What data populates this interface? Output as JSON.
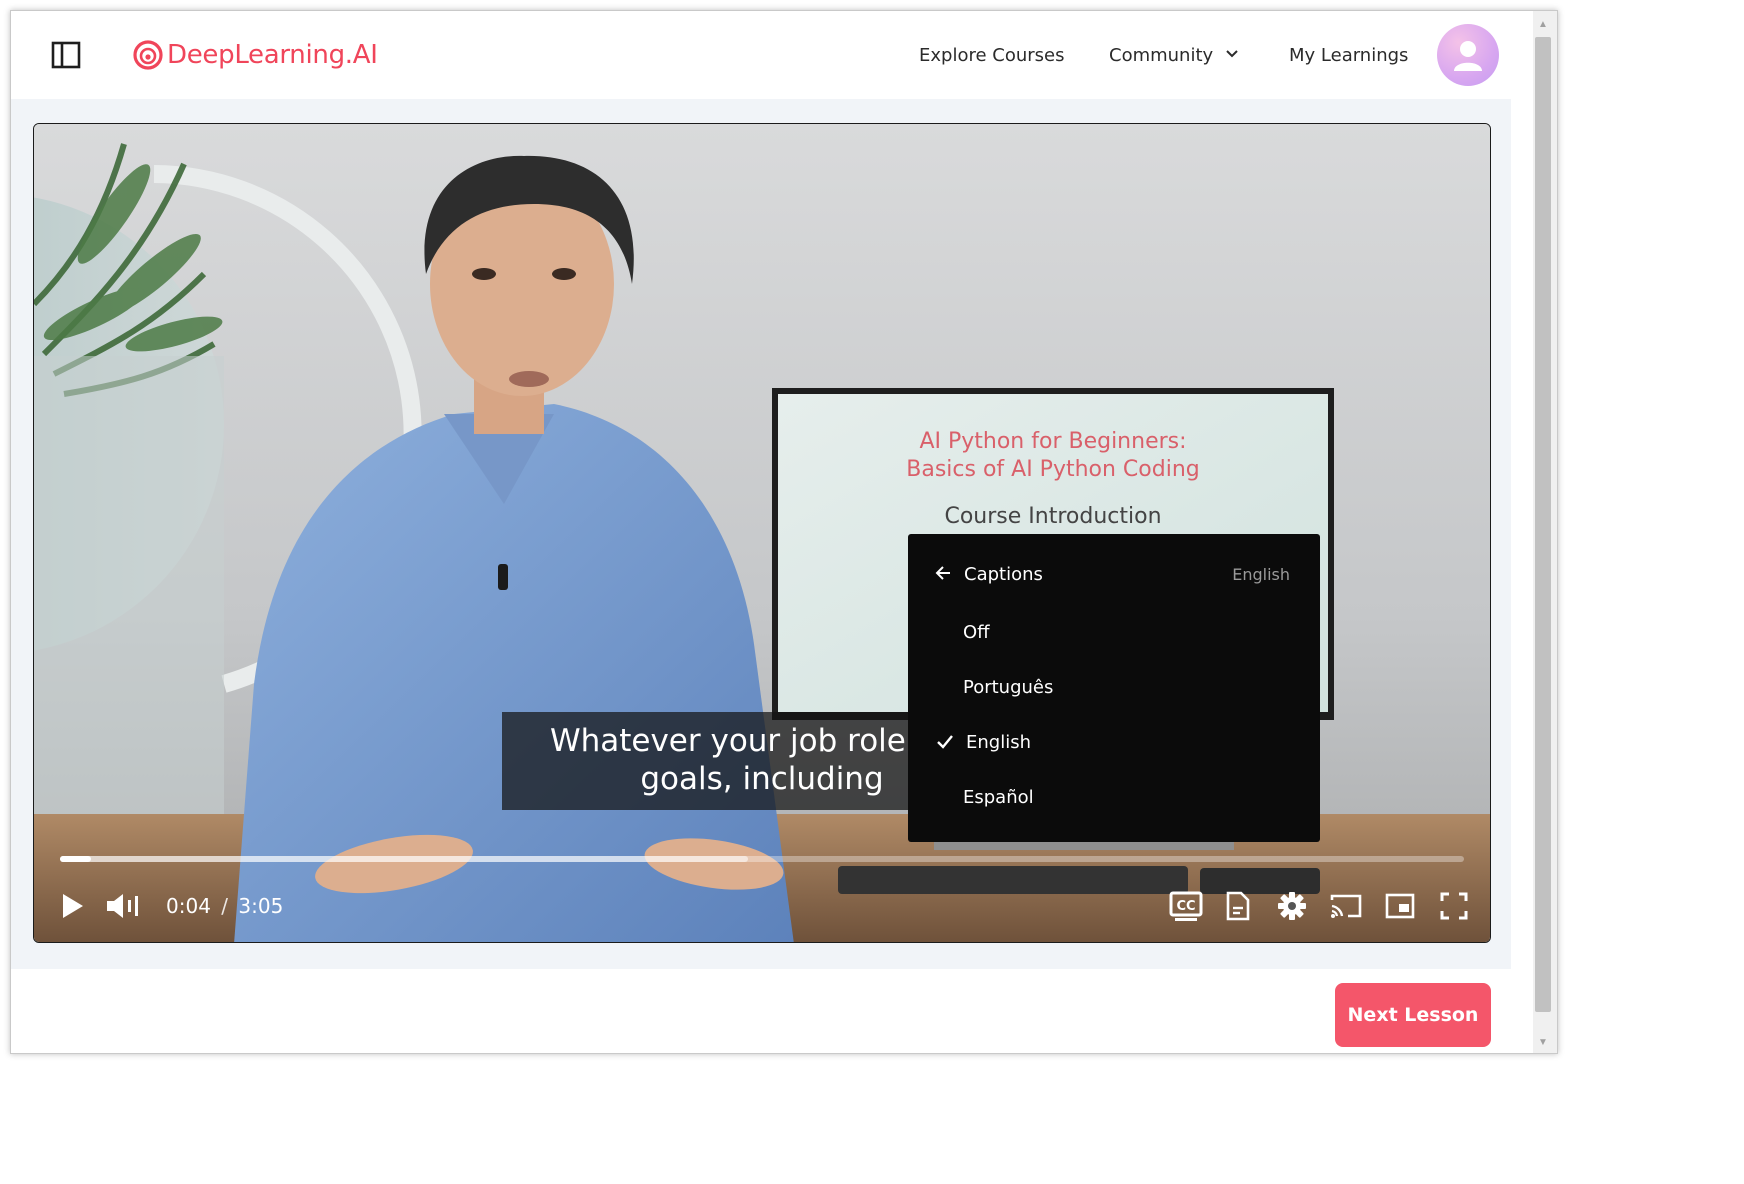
{
  "header": {
    "logo_text": "DeepLearning.AI",
    "nav": {
      "explore": "Explore Courses",
      "community": "Community",
      "my_learnings": "My Learnings"
    }
  },
  "video": {
    "screen_title_line1": "AI Python for Beginners:",
    "screen_title_line2": "Basics of AI Python Coding",
    "screen_subtitle": "Course Introduction",
    "caption_line1": "Whatever your job role and",
    "caption_line2": "goals, including",
    "current_time": "0:04",
    "time_separator": "/",
    "duration": "3:05",
    "played_fraction": 0.022,
    "buffered_fraction": 0.49
  },
  "captions_menu": {
    "title": "Captions",
    "current": "English",
    "options": [
      "Off",
      "Português",
      "English",
      "Español"
    ],
    "selected": "English"
  },
  "footer": {
    "next_lesson": "Next Lesson"
  },
  "colors": {
    "brand": "#f0455a",
    "next_button": "#f4566a",
    "menu_bg": "#0b0b0b"
  }
}
